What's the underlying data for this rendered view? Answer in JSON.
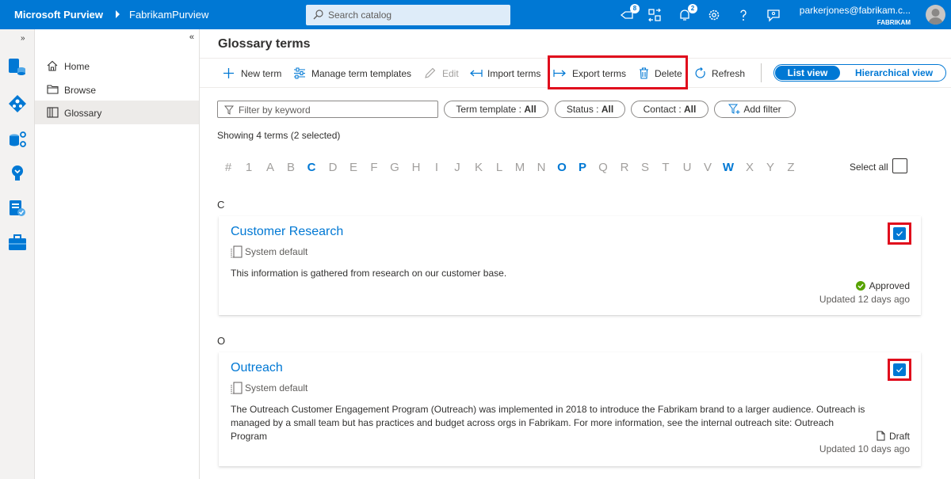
{
  "app": {
    "brand": "Microsoft Purview",
    "account": "FabrikamPurview",
    "search_placeholder": "Search catalog",
    "notifications": {
      "tasks_count": "8",
      "alerts_count": "2"
    },
    "user_email": "parkerjones@fabrikam.c...",
    "user_org": "FABRIKAM"
  },
  "nav": {
    "items": [
      {
        "label": "Home",
        "icon": "home-icon"
      },
      {
        "label": "Browse",
        "icon": "folder-icon"
      },
      {
        "label": "Glossary",
        "icon": "book-icon",
        "selected": true
      }
    ]
  },
  "page": {
    "title": "Glossary terms",
    "commands": {
      "new_term": "New term",
      "manage_templates": "Manage term templates",
      "edit": "Edit",
      "import_terms": "Import terms",
      "export_terms": "Export terms",
      "delete": "Delete",
      "refresh": "Refresh"
    },
    "views": {
      "list": "List view",
      "hierarchical": "Hierarchical view",
      "selected": "list"
    },
    "filter_placeholder": "Filter by keyword",
    "filters": [
      {
        "label": "Term template : ",
        "value": "All"
      },
      {
        "label": "Status : ",
        "value": "All"
      },
      {
        "label": "Contact : ",
        "value": "All"
      }
    ],
    "add_filter": "Add filter",
    "showing": "Showing 4 terms (2 selected)",
    "alphabet": [
      "#",
      "1",
      "A",
      "B",
      "C",
      "D",
      "E",
      "F",
      "G",
      "H",
      "I",
      "J",
      "K",
      "L",
      "M",
      "N",
      "O",
      "P",
      "Q",
      "R",
      "S",
      "T",
      "U",
      "V",
      "W",
      "X",
      "Y",
      "Z"
    ],
    "active_letters": [
      "C",
      "O",
      "P",
      "W"
    ],
    "select_all": "Select all"
  },
  "groups": [
    {
      "letter": "C",
      "terms": [
        {
          "name": "Customer Research",
          "template": "System default",
          "description": "This information is gathered from research on our customer base.",
          "status": "Approved",
          "updated": "Updated 12 days ago",
          "selected": true
        }
      ]
    },
    {
      "letter": "O",
      "terms": [
        {
          "name": "Outreach",
          "template": "System default",
          "description": "The Outreach Customer Engagement Program (Outreach) was implemented in 2018 to introduce the Fabrikam brand to a larger audience. Outreach is managed by a small team but has practices and budget across orgs in Fabrikam. For more information, see the internal outreach site: Outreach Program",
          "status": "Draft",
          "updated": "Updated 10 days ago",
          "selected": true
        }
      ]
    }
  ],
  "colors": {
    "accent": "#0078d4",
    "highlight": "#e00b1c",
    "approved": "#57a300"
  }
}
